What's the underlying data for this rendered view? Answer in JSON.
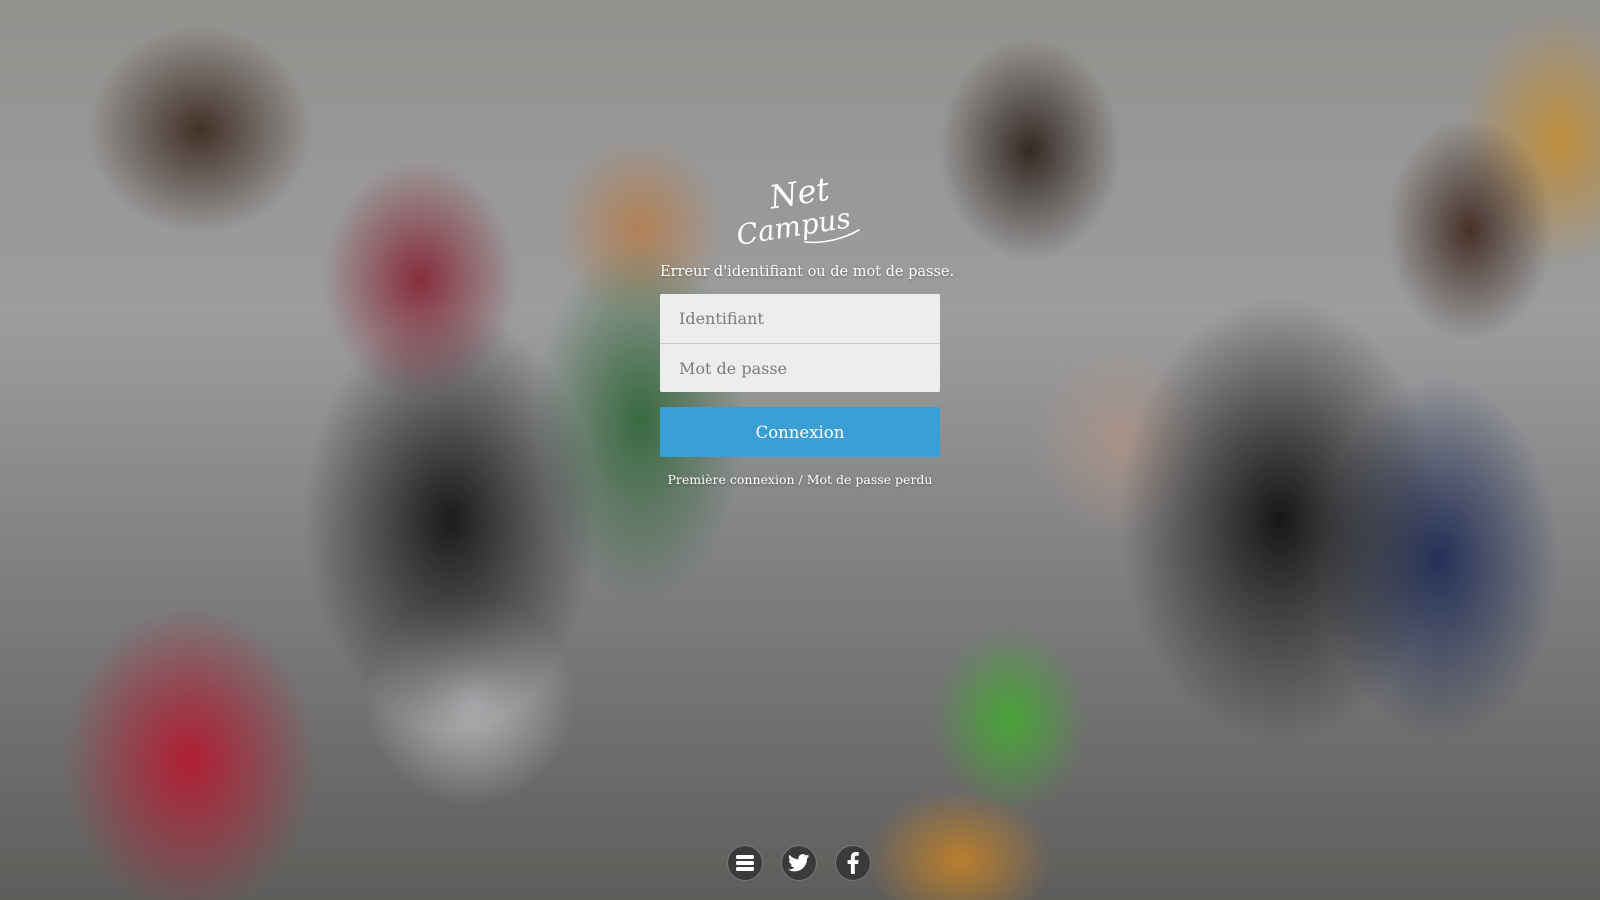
{
  "app": {
    "brand_line1": "Net",
    "brand_line2": "Campus"
  },
  "login": {
    "error_message": "Erreur d'identifiant ou de mot de passe.",
    "username_placeholder": "Identifiant",
    "password_placeholder": "Mot de passe",
    "submit_label": "Connexion",
    "first_login_link": "Première connexion",
    "link_separator": " / ",
    "lost_password_link": "Mot de passe perdu"
  },
  "social": [
    {
      "icon": "list-icon",
      "label": "Blog"
    },
    {
      "icon": "twitter-icon",
      "label": "Twitter"
    },
    {
      "icon": "facebook-icon",
      "label": "Facebook"
    }
  ],
  "colors": {
    "accent": "#3a9fd4",
    "field_bg": "#ededed",
    "social_bg": "#3a3a3a"
  }
}
